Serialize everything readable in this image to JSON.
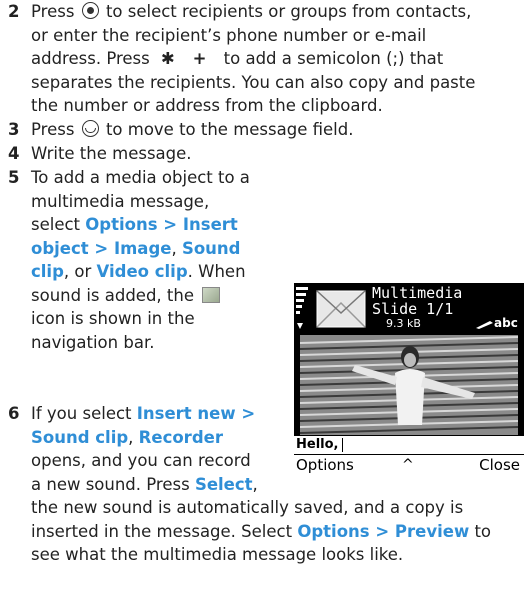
{
  "step2": {
    "number": "2",
    "line1_pre": "Press",
    "line1_post": "to select recipients or groups from contacts,",
    "line2": "or enter the recipient’s phone number or e-mail",
    "line3_pre": "address. Press",
    "line3_keys": "✱ +",
    "line3_post": "to add a semicolon (;) that",
    "line4": "separates the recipients. You can also copy and paste",
    "line5": "the number or address from the clipboard."
  },
  "step3": {
    "number": "3",
    "pre": "Press",
    "post": "to move to the message field."
  },
  "step4": {
    "number": "4",
    "text": "Write the message."
  },
  "step5": {
    "number": "5",
    "line1": "To add a media object to a",
    "line2": "multimedia message,",
    "line3": "select",
    "link_options_insert_object": "Options > Insert",
    "link_object_image": "object > Image",
    "comma1": ",",
    "link_sound": "Sound",
    "link_clip": "clip",
    "or": ", or",
    "link_video_clip": "Video clip",
    "when": ". When",
    "line5_pre": "sound is added, the",
    "line6": "icon is shown in the",
    "line7": "navigation bar."
  },
  "step6": {
    "number": "6",
    "pre": "If you select",
    "link_insert_new": "Insert new >",
    "link_sound_clip": "Sound clip",
    "comma": ",",
    "link_recorder": "Recorder",
    "line3": "opens, and you can record",
    "line4_pre": "a new sound. Press",
    "link_select": "Select",
    "line4_post": ",",
    "line5": "the new sound is automatically saved, and a copy is",
    "line6_pre": "inserted in the message. Select",
    "link_options_preview": "Options > Preview",
    "line6_post": "to",
    "line7": "see what the multimedia message looks like."
  },
  "phone": {
    "title_line1": "Multimedia",
    "title_line2": "Slide 1/1",
    "size": "9.3 kB",
    "input_mode": "abc",
    "message_text": "Hello,",
    "left_softkey": "Options",
    "right_softkey": "Close",
    "middle_symbol": "^"
  }
}
